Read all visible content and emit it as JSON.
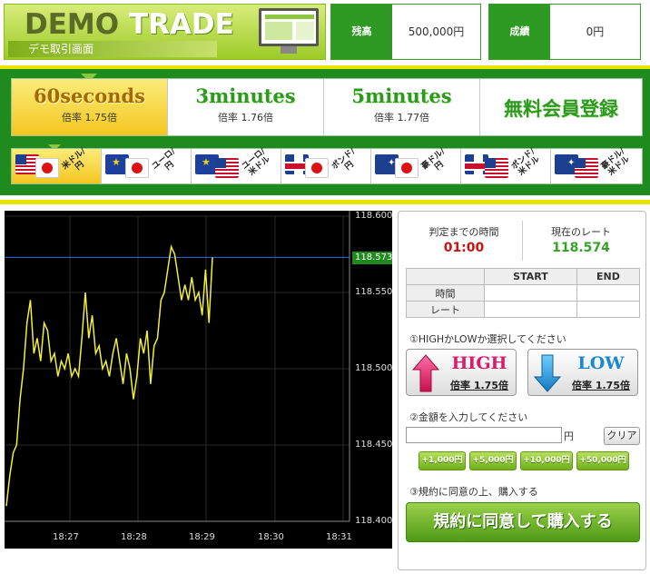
{
  "header": {
    "logo_demo": "DEMO",
    "logo_trade": "TRADE",
    "logo_subtitle": "デモ取引画面",
    "balance_label": "残高",
    "balance_value": "500,000円",
    "result_label": "成績",
    "result_value": "0円"
  },
  "time_tabs": [
    {
      "name": "60seconds",
      "mult": "倍率 1.75倍",
      "active": true
    },
    {
      "name": "3minutes",
      "mult": "倍率 1.76倍",
      "active": false
    },
    {
      "name": "5minutes",
      "mult": "倍率 1.77倍",
      "active": false
    },
    {
      "name": "無料会員登録",
      "mult": "",
      "active": false
    }
  ],
  "pair_tabs": [
    {
      "label": "米ドル/円",
      "flags": [
        "us",
        "jp"
      ],
      "active": true
    },
    {
      "label": "ユーロ/円",
      "flags": [
        "eu",
        "jp"
      ],
      "active": false
    },
    {
      "label": "ユーロ/米ドル",
      "flags": [
        "eu",
        "us"
      ],
      "active": false
    },
    {
      "label": "ポンド/円",
      "flags": [
        "gb",
        "jp"
      ],
      "active": false
    },
    {
      "label": "豪ドル/円",
      "flags": [
        "au",
        "jp"
      ],
      "active": false
    },
    {
      "label": "ポンド/米ドル",
      "flags": [
        "gb",
        "us"
      ],
      "active": false
    },
    {
      "label": "豪ドル/米ドル",
      "flags": [
        "au",
        "us"
      ],
      "active": false
    }
  ],
  "chart_data": {
    "type": "line",
    "x_ticks": [
      "18:27",
      "18:28",
      "18:29",
      "18:30",
      "18:31"
    ],
    "y_ticks": [
      "118.600",
      "118.550",
      "118.500",
      "118.450",
      "118.400"
    ],
    "ylim": [
      118.4,
      118.6
    ],
    "current_rate_label": "118.573",
    "current_rate": 118.573,
    "line_color": "#f2ef3a",
    "series": [
      {
        "values": [
          118.41,
          118.43,
          118.445,
          118.45,
          118.48,
          118.5,
          118.53,
          118.545,
          118.51,
          118.52,
          118.505,
          118.53,
          118.525,
          118.505,
          118.51,
          118.495,
          118.505,
          118.5,
          118.51,
          118.495,
          118.5,
          118.495,
          118.52,
          118.55,
          118.52,
          118.535,
          118.51,
          118.515,
          118.5,
          118.505,
          118.495,
          118.51,
          118.52,
          118.505,
          118.49,
          118.51,
          118.5,
          118.48,
          118.495,
          118.52,
          118.51,
          118.525,
          118.49,
          118.515,
          118.52,
          118.545,
          118.55,
          118.565,
          118.58,
          118.575,
          118.56,
          118.545,
          118.555,
          118.545,
          118.56,
          118.545,
          118.55,
          118.535,
          118.565,
          118.53,
          118.573
        ]
      }
    ]
  },
  "panel": {
    "timer_label": "判定までの時間",
    "timer_value": "01:00",
    "rate_label": "現在のレート",
    "rate_value": "118.574",
    "table_headers": [
      "",
      "START",
      "END"
    ],
    "table_rows": [
      "時間",
      "レート"
    ],
    "step1": "①HIGHかLOWか選択してください",
    "high_label": "HIGH",
    "high_mult": "倍率 1.75倍",
    "low_label": "LOW",
    "low_mult": "倍率 1.75倍",
    "step2": "②金額を入力してください",
    "amount_value": "",
    "yen": "円",
    "clear": "クリア",
    "add_buttons": [
      "+1,000円",
      "+5,000円",
      "+10,000円",
      "+50,000円"
    ],
    "step3": "③規約に同意の上、購入する",
    "buy": "規約に同意して購入する"
  },
  "colors": {
    "brand_green": "#1f8b1f",
    "accent_yellow": "#e8e300",
    "high_pink": "#d81b6a",
    "low_blue": "#1888d0"
  }
}
